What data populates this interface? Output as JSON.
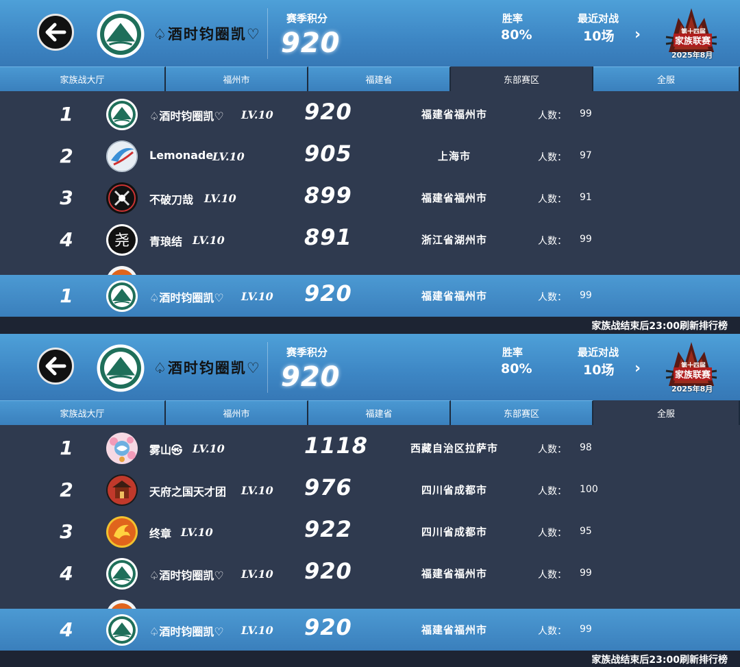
{
  "panels": [
    {
      "header": {
        "family_name": "♤酒时钧圈凯♡",
        "score_label": "赛季积分",
        "score_value": "920",
        "winrate_label": "胜率",
        "winrate_value": "80%",
        "recent_label": "最近对战",
        "recent_value": "10场",
        "league_top": "第十四届",
        "league_name": "家族联赛",
        "league_date": "2025年8月"
      },
      "tabs": [
        "家族战大厅",
        "福州市",
        "福建省",
        "东部赛区",
        "全服"
      ],
      "active_tab": 3,
      "rows": [
        {
          "rank": "1",
          "name": "♤酒时钧圈凯♡",
          "level": "LV.10",
          "score": "920",
          "region": "福建省福州市",
          "members_label": "人数：",
          "members": "99",
          "emblem": "mountain"
        },
        {
          "rank": "2",
          "name": "Lemonade",
          "level": "LV.10",
          "score": "905",
          "region": "上海市",
          "members_label": "人数：",
          "members": "97",
          "emblem": "swoosh"
        },
        {
          "rank": "3",
          "name": "不破刀哉",
          "level": "LV.10",
          "score": "899",
          "region": "福建省福州市",
          "members_label": "人数：",
          "members": "91",
          "emblem": "swords"
        },
        {
          "rank": "4",
          "name": "青琅结",
          "level": "LV.10",
          "score": "891",
          "region": "浙江省湖州市",
          "members_label": "人数：",
          "members": "99",
          "emblem": "character"
        }
      ],
      "my_row": {
        "rank": "1",
        "name": "♤酒时钧圈凯♡",
        "level": "LV.10",
        "score": "920",
        "region": "福建省福州市",
        "members_label": "人数：",
        "members": "99"
      },
      "footer": "家族战结束后23:00刷新排行榜"
    },
    {
      "header": {
        "family_name": "♤酒时钧圈凯♡",
        "score_label": "赛季积分",
        "score_value": "920",
        "winrate_label": "胜率",
        "winrate_value": "80%",
        "recent_label": "最近对战",
        "recent_value": "10场",
        "league_top": "第十四届",
        "league_name": "家族联赛",
        "league_date": "2025年8月"
      },
      "tabs": [
        "家族战大厅",
        "福州市",
        "福建省",
        "东部赛区",
        "全服"
      ],
      "active_tab": 4,
      "rows": [
        {
          "rank": "1",
          "name": "雾山㉿",
          "level": "LV.10",
          "score": "1118",
          "region": "西藏自治区拉萨市",
          "members_label": "人数：",
          "members": "98",
          "emblem": "flower"
        },
        {
          "rank": "2",
          "name": "天府之国天才团",
          "level": "LV.10",
          "score": "976",
          "region": "四川省成都市",
          "members_label": "人数：",
          "members": "100",
          "emblem": "temple"
        },
        {
          "rank": "3",
          "name": "终章",
          "level": "LV.10",
          "score": "922",
          "region": "四川省成都市",
          "members_label": "人数：",
          "members": "95",
          "emblem": "phoenix"
        },
        {
          "rank": "4",
          "name": "♤酒时钧圈凯♡",
          "level": "LV.10",
          "score": "920",
          "region": "福建省福州市",
          "members_label": "人数：",
          "members": "99",
          "emblem": "mountain"
        }
      ],
      "my_row": {
        "rank": "4",
        "name": "♤酒时钧圈凯♡",
        "level": "LV.10",
        "score": "920",
        "region": "福建省福州市",
        "members_label": "人数：",
        "members": "99"
      },
      "footer": "家族战结束后23:00刷新排行榜"
    }
  ],
  "colors": {
    "header_blue": "#4ea0d8",
    "list_bg": "#2f3a4f",
    "footer_bg": "#1d2433",
    "emblem_green": "#1f6f5a"
  }
}
